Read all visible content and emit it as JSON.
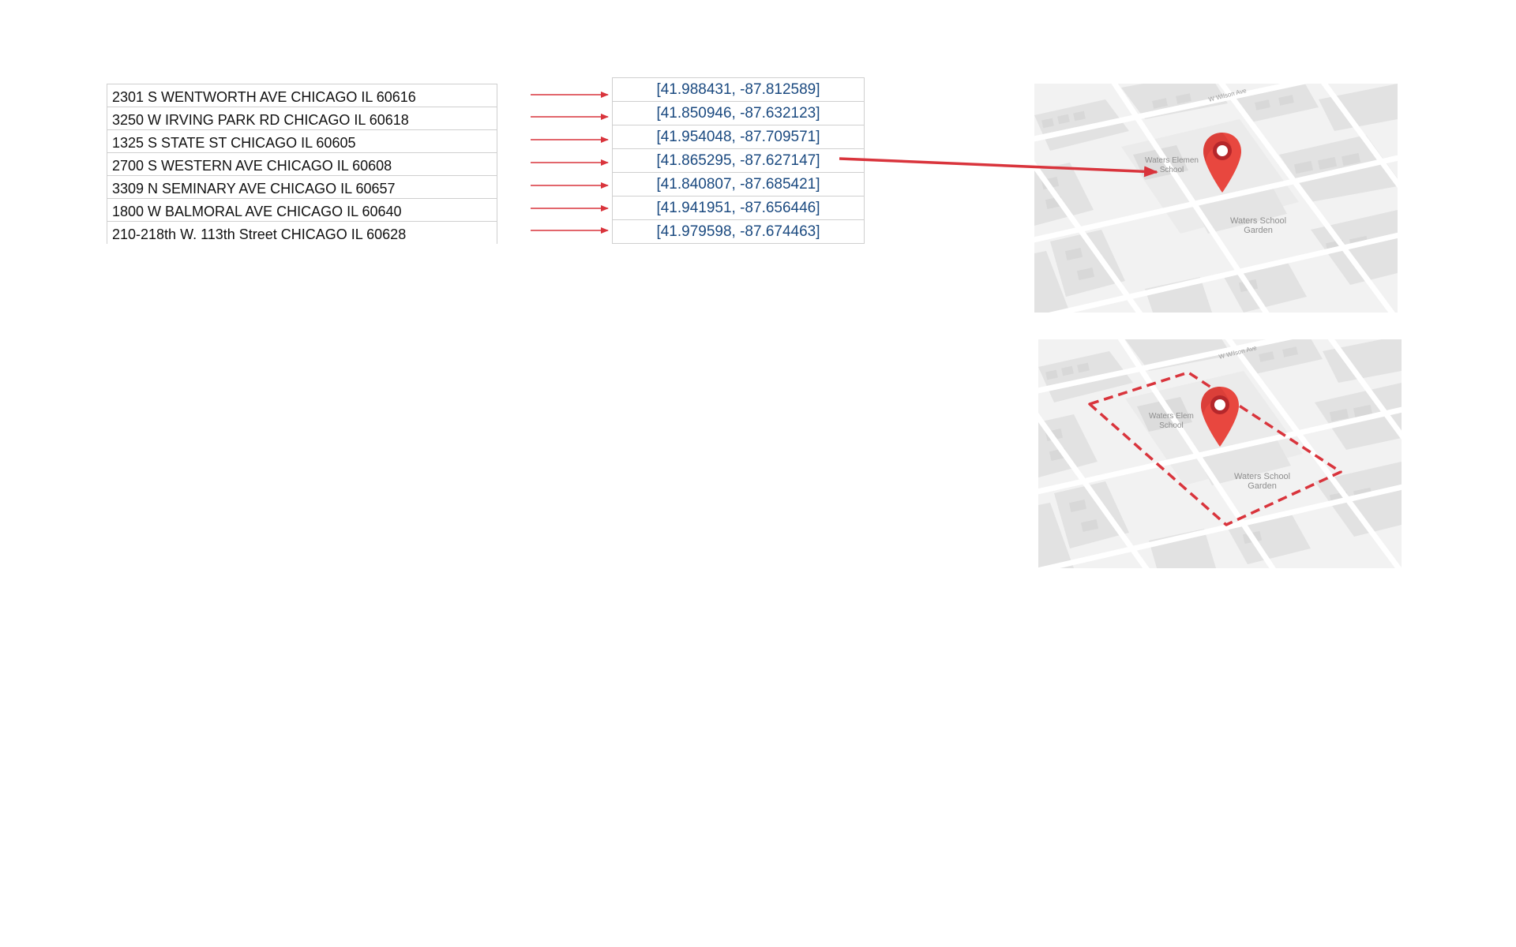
{
  "addresses": [
    "2301 S WENTWORTH AVE CHICAGO IL 60616",
    "3250 W IRVING PARK RD CHICAGO IL 60618",
    "1325 S STATE ST CHICAGO IL 60605",
    "2700 S WESTERN AVE CHICAGO IL 60608",
    "3309 N SEMINARY AVE CHICAGO IL 60657",
    "1800 W BALMORAL AVE CHICAGO IL 60640",
    "210-218th W. 113th Street CHICAGO IL 60628"
  ],
  "coordinates": [
    "[41.988431, -87.812589]",
    "[41.850946, -87.632123]",
    "[41.954048, -87.709571]",
    "[41.865295, -87.627147]",
    "[41.840807, -87.685421]",
    "[41.941951, -87.656446]",
    "[41.979598, -87.674463]"
  ],
  "map_top": {
    "school_label_1": "Waters Elemen",
    "school_label_2": "School",
    "garden_label_1": "Waters School",
    "garden_label_2": "Garden",
    "street_label": "W Wilson Ave"
  },
  "map_bottom": {
    "school_label_1": "Waters Elem",
    "school_label_2": "School",
    "garden_label_1": "Waters School",
    "garden_label_2": "Garden",
    "street_label": "W Wilson Ave"
  },
  "colors": {
    "arrow": "#d9343c",
    "pin": "#e8473f",
    "pin_dark": "#b5272b",
    "coord_text": "#1b4a80",
    "map_bg": "#f2f2f2"
  },
  "icons": [
    "map-pin-icon",
    "arrow-right-icon"
  ]
}
